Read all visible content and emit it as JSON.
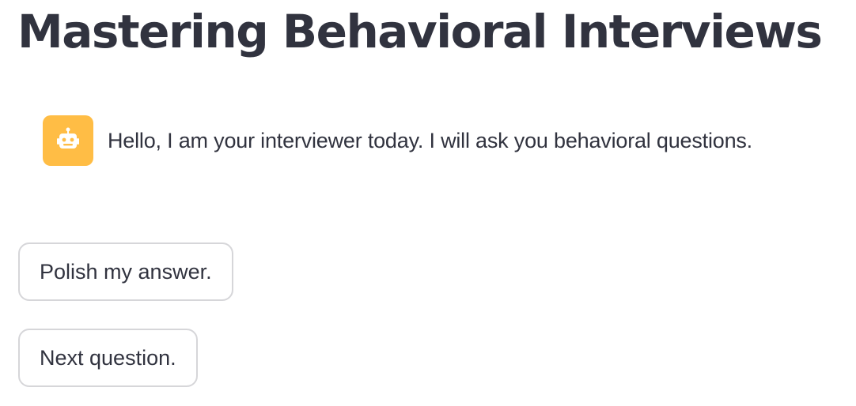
{
  "page": {
    "title": "Mastering Behavioral Interviews"
  },
  "chat": {
    "assistant_avatar_icon": "robot-icon",
    "assistant_avatar_color": "#ffbd45",
    "message": "Hello, I am your interviewer today. I will ask you behavioral questions."
  },
  "actions": {
    "polish_label": "Polish my answer.",
    "next_label": "Next question."
  }
}
